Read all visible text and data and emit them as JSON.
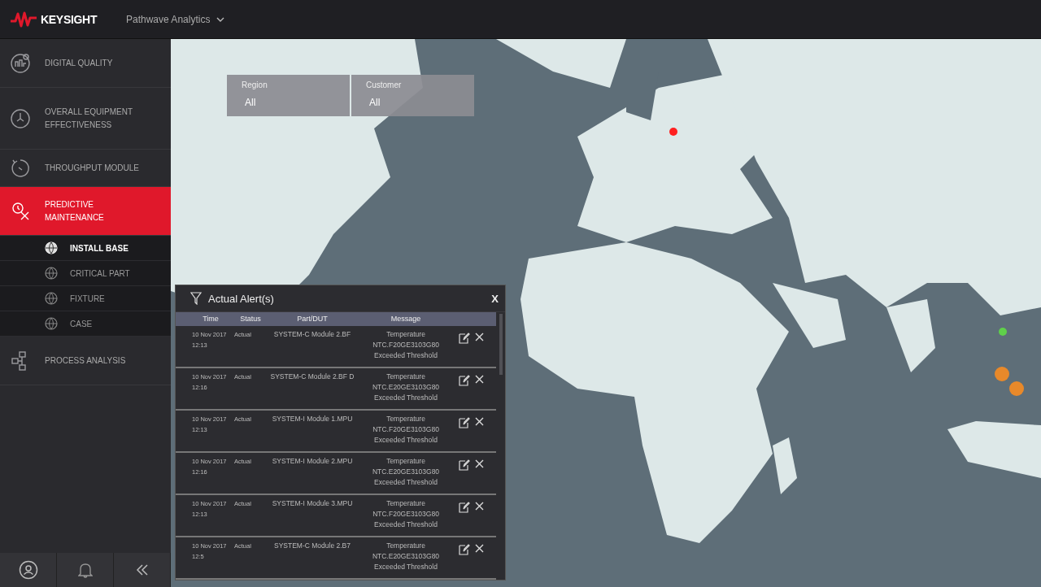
{
  "header": {
    "brand": "KEYSIGHT",
    "app_menu": "Pathwave Analytics"
  },
  "sidebar": {
    "items": [
      {
        "label": "DIGITAL QUALITY",
        "selected": false
      },
      {
        "label": "OVERALL EQUIPMENT EFFECTIVENESS",
        "selected": false
      },
      {
        "label": "THROUGHPUT MODULE",
        "selected": false
      },
      {
        "label": "PREDICTIVE MAINTENANCE",
        "selected": true,
        "expanded": true,
        "children": [
          {
            "label": "INSTALL BASE",
            "selected": true
          },
          {
            "label": "CRITICAL PART",
            "selected": false
          },
          {
            "label": "FIXTURE",
            "selected": false
          },
          {
            "label": "CASE",
            "selected": false
          }
        ]
      },
      {
        "label": "PROCESS ANALYSIS",
        "selected": false
      }
    ]
  },
  "filters": [
    {
      "label": "Region",
      "value": "All"
    },
    {
      "label": "Customer",
      "value": "All"
    }
  ],
  "alerts_panel": {
    "title": "Actual Alert(s)",
    "close": "X",
    "columns": [
      "Time",
      "Status",
      "Part/DUT",
      "Message"
    ],
    "rows": [
      {
        "date": "10 Nov 2017",
        "time": "12:13",
        "status": "Actual",
        "part": "SYSTEM-C Module 2.BF",
        "message": [
          "Temperature",
          "NTC.F20GE3103G80",
          "Exceeded Threshold"
        ]
      },
      {
        "date": "10 Nov 2017",
        "time": "12:16",
        "status": "Actual",
        "part": "SYSTEM-C Module 2.BF D",
        "message": [
          "Temperature",
          "NTC.E20GE3103G80",
          "Exceeded Threshold"
        ]
      },
      {
        "date": "10 Nov 2017",
        "time": "12:13",
        "status": "Actual",
        "part": "SYSTEM-I Module 1.MPU",
        "message": [
          "Temperature",
          "NTC.F20GE3103G80",
          "Exceeded Threshold"
        ]
      },
      {
        "date": "10 Nov 2017",
        "time": "12:16",
        "status": "Actual",
        "part": "SYSTEM-I Module 2.MPU",
        "message": [
          "Temperature",
          "NTC.E20GE3103G80",
          "Exceeded Threshold"
        ]
      },
      {
        "date": "10 Nov 2017",
        "time": "12:13",
        "status": "Actual",
        "part": "SYSTEM-I Module 3.MPU",
        "message": [
          "Temperature",
          "NTC.F20GE3103G80",
          "Exceeded Threshold"
        ]
      },
      {
        "date": "10 Nov 2017",
        "time": "12:5",
        "status": "Actual",
        "part": "SYSTEM-C Module 2.B7",
        "message": [
          "Temperature",
          "NTC.E20GE3103G80",
          "Exceeded Threshold"
        ]
      }
    ]
  }
}
